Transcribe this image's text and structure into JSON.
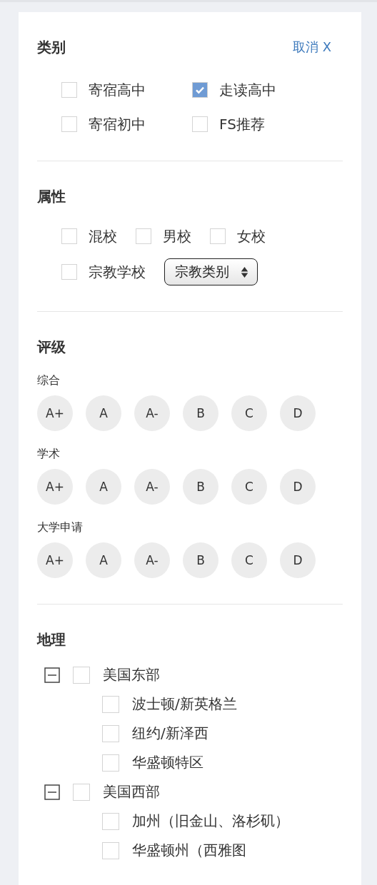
{
  "category": {
    "title": "类别",
    "cancel": "取消 X",
    "options": [
      {
        "label": "寄宿高中",
        "checked": false
      },
      {
        "label": "走读高中",
        "checked": true
      },
      {
        "label": "寄宿初中",
        "checked": false
      },
      {
        "label": "FS推荐",
        "checked": false
      }
    ]
  },
  "attributes": {
    "title": "属性",
    "options": [
      {
        "label": "混校",
        "checked": false
      },
      {
        "label": "男校",
        "checked": false
      },
      {
        "label": "女校",
        "checked": false
      },
      {
        "label": "宗教学校",
        "checked": false
      }
    ],
    "select": {
      "value": "宗教类别"
    }
  },
  "rating": {
    "title": "评级",
    "groups": [
      {
        "label": "综合",
        "grades": [
          {
            "label": "A+",
            "selected": false
          },
          {
            "label": "A",
            "selected": false
          },
          {
            "label": "A-",
            "selected": false
          },
          {
            "label": "B",
            "selected": false
          },
          {
            "label": "C",
            "selected": false
          },
          {
            "label": "D",
            "selected": false
          }
        ]
      },
      {
        "label": "学术",
        "grades": [
          {
            "label": "A+",
            "selected": false
          },
          {
            "label": "A",
            "selected": false
          },
          {
            "label": "A-",
            "selected": false
          },
          {
            "label": "B",
            "selected": false
          },
          {
            "label": "C",
            "selected": false
          },
          {
            "label": "D",
            "selected": false
          }
        ]
      },
      {
        "label": "大学申请",
        "grades": [
          {
            "label": "A+",
            "selected": false
          },
          {
            "label": "A",
            "selected": false
          },
          {
            "label": "A-",
            "selected": false
          },
          {
            "label": "B",
            "selected": false
          },
          {
            "label": "C",
            "selected": false
          },
          {
            "label": "D",
            "selected": false
          }
        ]
      }
    ]
  },
  "geography": {
    "title": "地理",
    "regions": [
      {
        "label": "美国东部",
        "checked": false,
        "expanded": true,
        "children": [
          {
            "label": "波士顿/新英格兰",
            "checked": false
          },
          {
            "label": "纽约/新泽西",
            "checked": false
          },
          {
            "label": "华盛顿特区",
            "checked": false
          }
        ]
      },
      {
        "label": "美国西部",
        "checked": false,
        "expanded": true,
        "children": [
          {
            "label": "加州（旧金山、洛杉矶）",
            "checked": false
          },
          {
            "label": "华盛顿州（西雅图",
            "checked": false
          }
        ]
      }
    ]
  }
}
